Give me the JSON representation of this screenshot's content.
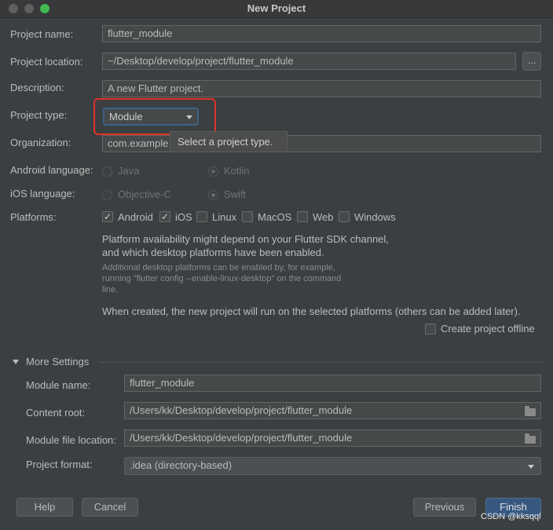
{
  "window": {
    "title": "New Project"
  },
  "form": {
    "project_name_label": "Project name:",
    "project_name_value": "flutter_module",
    "project_location_label": "Project location:",
    "project_location_value": "~/Desktop/develop/project/flutter_module",
    "browse_label": "...",
    "description_label": "Description:",
    "description_value": "A new Flutter project.",
    "project_type_label": "Project type:",
    "project_type_value": "Module",
    "project_type_tooltip": "Select a project type.",
    "organization_label": "Organization:",
    "organization_value": "com.example",
    "android_language_label": "Android language:",
    "android_options": [
      "Java",
      "Kotlin"
    ],
    "android_selected": "Kotlin",
    "ios_language_label": "iOS language:",
    "ios_options": [
      "Objective-C",
      "Swift"
    ],
    "ios_selected": "Swift",
    "platforms_label": "Platforms:",
    "platforms": [
      {
        "name": "Android",
        "checked": true
      },
      {
        "name": "iOS",
        "checked": true
      },
      {
        "name": "Linux",
        "checked": false
      },
      {
        "name": "MacOS",
        "checked": false
      },
      {
        "name": "Web",
        "checked": false
      },
      {
        "name": "Windows",
        "checked": false
      }
    ],
    "platform_info_line1": "Platform availability might depend on your Flutter SDK channel,",
    "platform_info_line2": "and which desktop platforms have been enabled.",
    "platform_hint_line1": "Additional desktop platforms can be enabled by, for example,",
    "platform_hint_line2": "running \"flutter config --enable-linux-desktop\" on the command",
    "platform_hint_line3": "line.",
    "created_note": "When created, the new project will run on the selected platforms (others can be added later).",
    "offline_label": "Create project offline",
    "offline_checked": false
  },
  "more_settings": {
    "header": "More Settings",
    "module_name_label": "Module name:",
    "module_name_value": "flutter_module",
    "content_root_label": "Content root:",
    "content_root_value": "/Users/kk/Desktop/develop/project/flutter_module",
    "module_file_label": "Module file location:",
    "module_file_value": "/Users/kk/Desktop/develop/project/flutter_module",
    "project_format_label": "Project format:",
    "project_format_value": ".idea (directory-based)"
  },
  "footer": {
    "help": "Help",
    "cancel": "Cancel",
    "previous": "Previous",
    "finish": "Finish"
  },
  "watermark": "CSDN @kksqql",
  "colors": {
    "accent": "#365880",
    "highlight": "#e0322a",
    "background": "#3c3f41"
  }
}
